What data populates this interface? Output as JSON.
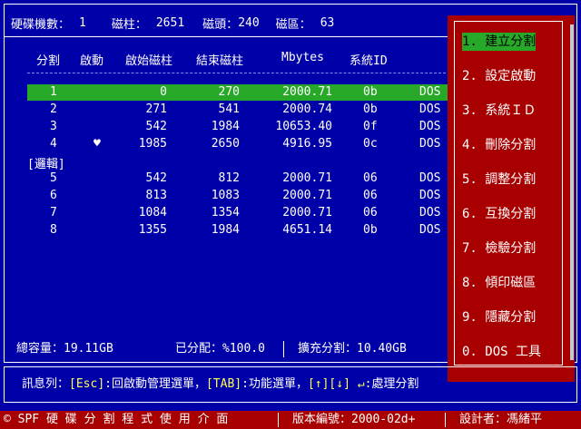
{
  "header": {
    "cyl_label": "硬碟機數：",
    "cyl_value": "1",
    "cylinders_label": "磁柱：",
    "cylinders_value": "2651",
    "heads_label": "磁頭：",
    "heads_value": "240",
    "sectors_label": "磁區：",
    "sectors_value": "63"
  },
  "columns": [
    "分割",
    "啟動",
    "啟始磁柱",
    "結束磁柱",
    "Mbytes",
    "系統ID"
  ],
  "partitions": [
    {
      "num": "1",
      "boot": "",
      "start": "0",
      "end": "270",
      "mb": "2000.71",
      "id": "0b",
      "fs": "DOS"
    },
    {
      "num": "2",
      "boot": "",
      "start": "271",
      "end": "541",
      "mb": "2000.74",
      "id": "0b",
      "fs": "DOS"
    },
    {
      "num": "3",
      "boot": "",
      "start": "542",
      "end": "1984",
      "mb": "10653.40",
      "id": "0f",
      "fs": "DOS"
    },
    {
      "num": "4",
      "boot": "♥",
      "start": "1985",
      "end": "2650",
      "mb": "4916.95",
      "id": "0c",
      "fs": "DOS"
    }
  ],
  "logical_label": "[邏輯]",
  "logical": [
    {
      "num": "5",
      "start": "542",
      "end": "812",
      "mb": "2000.71",
      "id": "06",
      "fs": "DOS"
    },
    {
      "num": "6",
      "start": "813",
      "end": "1083",
      "mb": "2000.71",
      "id": "06",
      "fs": "DOS"
    },
    {
      "num": "7",
      "start": "1084",
      "end": "1354",
      "mb": "2000.71",
      "id": "06",
      "fs": "DOS"
    },
    {
      "num": "8",
      "start": "1355",
      "end": "1984",
      "mb": "4651.14",
      "id": "0b",
      "fs": "DOS"
    }
  ],
  "summary": {
    "total": "總容量：19.11GB",
    "allocated": "已分配：%100.0",
    "extended": "擴充分割：10.40GB"
  },
  "menu": [
    "1. 建立分割",
    "2. 設定啟動",
    "3. 系統ＩＤ",
    "4. 刪除分割",
    "5. 調整分割",
    "6. 互換分割",
    "7. 檢驗分割",
    "8. 傾印磁區",
    "9. 隱藏分割",
    "0. DOS 工具"
  ],
  "message": {
    "label": "訊息列：",
    "esc_key": "[Esc]",
    "esc_text": ":回啟動管理選單，",
    "tab_key": "[TAB]",
    "tab_text": ":功能選單，",
    "arrow_key": "[↑][↓] ↵",
    "arrow_text": ":處理分割"
  },
  "status": {
    "program": "© SPF 硬 碟 分 割 程 式 使 用 介 面",
    "version": "版本編號：2000-02d+",
    "designer": "設計者：馮緒平"
  },
  "colors": {
    "background": "#0000a8",
    "highlight": "#28a828",
    "menu_panel": "#a80000"
  }
}
